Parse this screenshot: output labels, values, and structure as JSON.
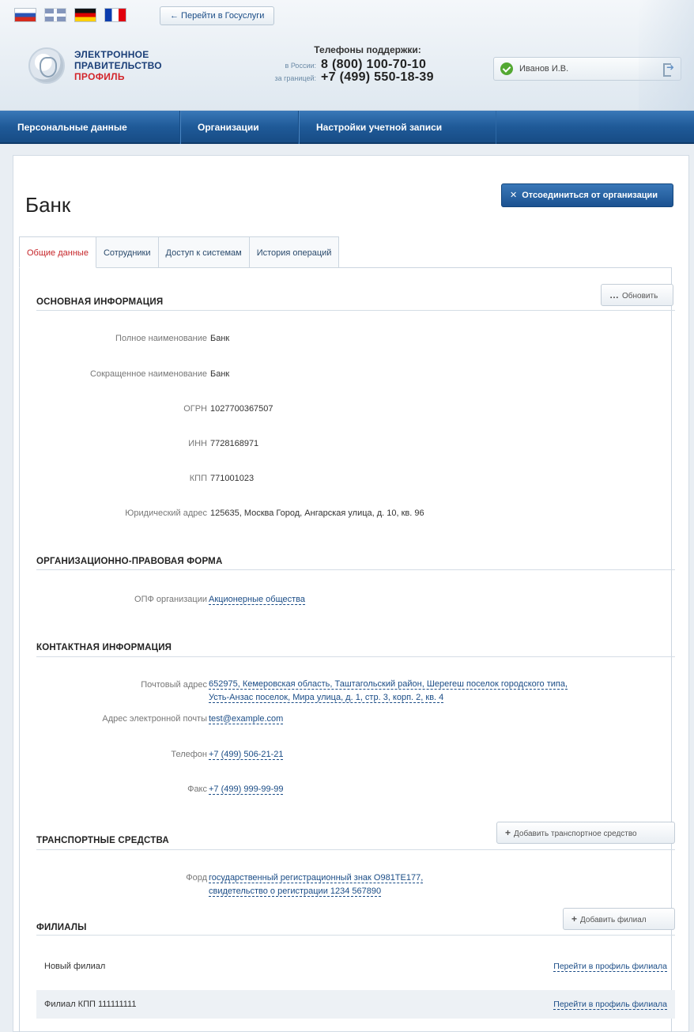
{
  "header": {
    "flags": [
      "ru",
      "gb",
      "de",
      "fr"
    ],
    "gosuslugi_link": "← Перейти в Госуслуги",
    "logo": {
      "line1": "ЭЛЕКТРОННОЕ",
      "line2": "ПРАВИТЕЛЬСТВО",
      "line3": "ПРОФИЛЬ"
    },
    "support": {
      "caption": "Телефоны поддержки:",
      "russia_label": "в России:",
      "russia_phone": "8 (800) 100-70-10",
      "abroad_label": "за границей:",
      "abroad_phone": "+7 (499) 550-18-39"
    },
    "user_name": "Иванов И.В."
  },
  "nav": {
    "items": [
      "Персональные данные",
      "Организации",
      "Настройки учетной записи"
    ]
  },
  "page": {
    "title": "Банк",
    "detach_button": "Отсоединиться от организации"
  },
  "tabs": [
    "Общие данные",
    "Сотрудники",
    "Доступ к системам",
    "История операций"
  ],
  "sections": {
    "main_info": {
      "title": "ОСНОВНАЯ ИНФОРМАЦИЯ",
      "refresh_button": "Обновить",
      "fields": [
        {
          "label": "Полное наименование",
          "value": "Банк"
        },
        {
          "label": "Сокращенное наименование",
          "value": "Банк"
        },
        {
          "label": "ОГРН",
          "value": "1027700367507"
        },
        {
          "label": "ИНН",
          "value": "7728168971"
        },
        {
          "label": "КПП",
          "value": "771001023"
        },
        {
          "label": "Юридический адрес",
          "value": "125635, Москва Город, Ангарская улица, д. 10, кв. 96"
        }
      ]
    },
    "legal_form": {
      "title": "ОРГАНИЗАЦИОННО-ПРАВОВАЯ ФОРМА",
      "label": "ОПФ организации",
      "value": "Акционерные общества"
    },
    "contacts": {
      "title": "КОНТАКТНАЯ ИНФОРМАЦИЯ",
      "postal_label": "Почтовый адрес",
      "postal_line1": "652975, Кемеровская область, Таштагольский район, Шерегеш поселок городского типа,",
      "postal_line2": "Усть-Анзас поселок, Мира улица, д. 1, стр. 3, корп. 2, кв. 4",
      "email_label": "Адрес электронной почты",
      "email_value": "test@example.com",
      "phone_label": "Телефон",
      "phone_value": "+7 (499) 506-21-21",
      "fax_label": "Факс",
      "fax_value": "+7 (499) 999-99-99"
    },
    "vehicles": {
      "title": "ТРАНСПОРТНЫЕ СРЕДСТВА",
      "add_button": "Добавить транспортное средство",
      "label": "Форд",
      "line1": "государственный регистрационный знак О981ТЕ177,",
      "line2": "свидетельство о регистрации 1234 567890"
    },
    "branches": {
      "title": "ФИЛИАЛЫ",
      "add_button": "Добавить филиал",
      "items": [
        {
          "name": "Новый филиал",
          "link": "Перейти в профиль филиала"
        },
        {
          "name": "Филиал КПП 111111111",
          "link": "Перейти в профиль филиала"
        }
      ]
    }
  }
}
